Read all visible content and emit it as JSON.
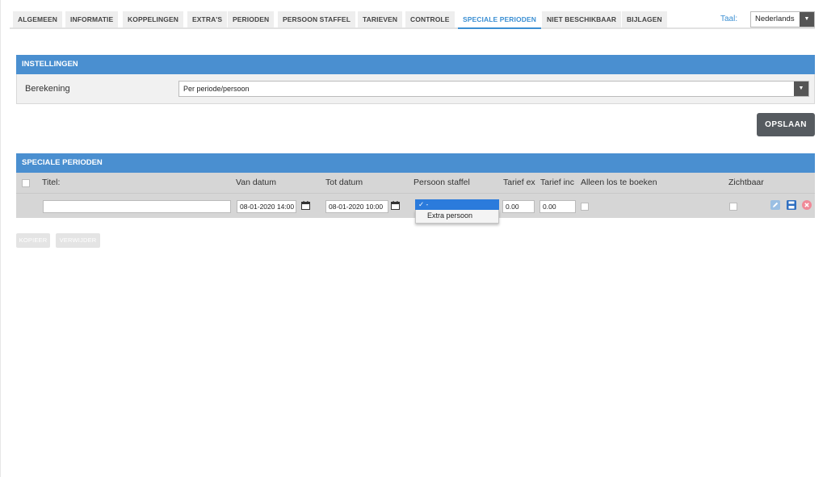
{
  "tabs": [
    {
      "label": "ALGEMEEN"
    },
    {
      "label": "INFORMATIE"
    },
    {
      "label": "KOPPELINGEN"
    },
    {
      "label": "EXTRA'S"
    },
    {
      "label": "PERIODEN"
    },
    {
      "label": "PERSOON STAFFEL"
    },
    {
      "label": "TARIEVEN"
    },
    {
      "label": "CONTROLE"
    },
    {
      "label": "SPECIALE PERIODEN",
      "active": true
    },
    {
      "label": "NIET BESCHIKBAAR"
    },
    {
      "label": "BIJLAGEN"
    }
  ],
  "language": {
    "label": "Taal:",
    "value": "Nederlands"
  },
  "settings": {
    "title": "INSTELLINGEN",
    "calc_label": "Berekening",
    "calc_value": "Per periode/persoon"
  },
  "save_label": "OPSLAAN",
  "special": {
    "title": "SPECIALE PERIODEN",
    "columns": {
      "title": "Titel:",
      "from": "Van datum",
      "to": "Tot datum",
      "staffel": "Persoon staffel",
      "rate_ex": "Tarief ex",
      "rate_inc": "Tarief inc",
      "only_separate": "Alleen los te boeken",
      "visible": "Zichtbaar"
    },
    "row": {
      "title": "",
      "from": "08-01-2020 14:00",
      "to": "08-01-2020 10:00",
      "staffel_selected": "✓ -",
      "staffel_option": "Extra persoon",
      "rate_ex": "0.00",
      "rate_inc": "0.00"
    }
  },
  "buttons": {
    "copy": "KOPIEER",
    "delete": "VERWIJDER"
  },
  "colors": {
    "accent": "#4a8fd0",
    "active_tab": "#3b8fd3",
    "select_highlight": "#2b7bdc",
    "delete_icon": "#f08a98"
  }
}
